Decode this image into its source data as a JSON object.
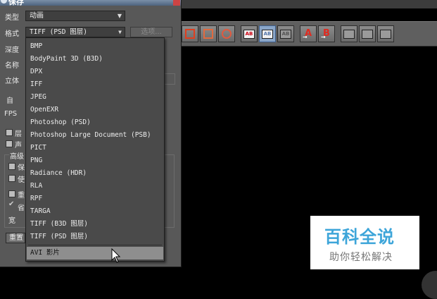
{
  "window": {
    "title": "保存"
  },
  "labels": {
    "type": "类型",
    "format": "格式",
    "depth": "深度",
    "name": "名称",
    "stereo": "立体",
    "auto": "自",
    "fps": "FPS",
    "layer": "层",
    "sound": "声",
    "advanced": "高级",
    "option_a": "保",
    "option_b": "使",
    "option_c": "重",
    "option_d": "省",
    "width": "宽"
  },
  "type_combo": {
    "value": "动画"
  },
  "format_combo": {
    "value": "TIFF (PSD 图层)"
  },
  "options_button": {
    "label": "选项..."
  },
  "reset_button": {
    "label": "重置"
  },
  "format_options": [
    "BMP",
    "BodyPaint 3D (B3D)",
    "DPX",
    "IFF",
    "JPEG",
    "OpenEXR",
    "Photoshop (PSD)",
    "Photoshop Large Document (PSB)",
    "PICT",
    "PNG",
    "Radiance (HDR)",
    "RLA",
    "RPF",
    "TARGA",
    "TIFF (B3D 图层)",
    "TIFF (PSD 图层)",
    "AVI 影片"
  ],
  "hovered_option": "AVI 影片",
  "toolbar": {
    "buttons": [
      {
        "icon": "frame-save-icon"
      },
      {
        "icon": "region-save-icon"
      },
      {
        "icon": "people-save-icon"
      },
      {
        "icon": "ab-compare-icon",
        "text": "AB"
      },
      {
        "icon": "ab-split-icon",
        "text": "AB",
        "active": true
      },
      {
        "icon": "ab-overlay-icon",
        "text": "AB"
      },
      {
        "icon": "a-to-icon",
        "text": "A"
      },
      {
        "icon": "b-to-icon",
        "text": "B"
      },
      {
        "icon": "channel-view-icon"
      },
      {
        "icon": "grid-view-icon"
      },
      {
        "icon": "frame-view-icon"
      }
    ]
  },
  "watermark": {
    "title": "百科全说",
    "subtitle": "助你轻松解决"
  },
  "colors": {
    "accent": "#3da5d9",
    "panel": "#585858",
    "hover": "#8e8e8e"
  }
}
